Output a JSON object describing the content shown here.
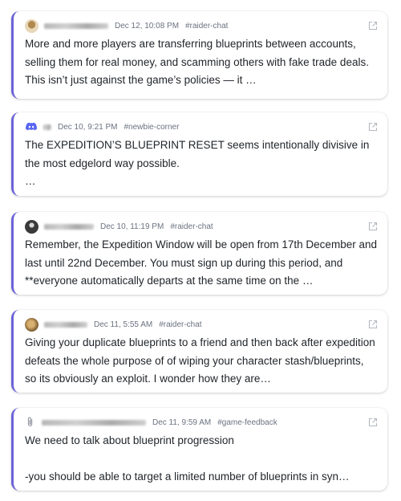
{
  "messages": [
    {
      "timestamp": "Dec 12, 10:08 PM",
      "channel": "#raider-chat",
      "avatar": "beige-avatar",
      "text": "More and more players are transferring blueprints between accounts, selling them for real money, and scamming others with fake trade deals. This isn’t just against the game’s policies — it …"
    },
    {
      "timestamp": "Dec 10, 9:21 PM",
      "channel": "#newbie-corner",
      "avatar": "discord-icon",
      "text": "The EXPEDITION’S BLUEPRINT RESET seems intentionally divisive in the most edgelord way possible.\n…"
    },
    {
      "timestamp": "Dec 10, 11:19 PM",
      "channel": "#raider-chat",
      "avatar": "dark-avatar",
      "text": "Remember, the Expedition Window will be open from 17th December and last until 22nd December. You must sign up during this period, and **everyone automatically departs at the same time on the …"
    },
    {
      "timestamp": "Dec 11, 5:55 AM",
      "channel": "#raider-chat",
      "avatar": "brown-avatar",
      "text": "Giving your duplicate blueprints to a friend and then back after expedition defeats the whole purpose of of wiping your character stash/blueprints, so its obviously an exploit. I wonder how they are…"
    },
    {
      "timestamp": "Dec 11, 9:59 AM",
      "channel": "#game-feedback",
      "avatar": "paperclip-avatar",
      "text": "We need to talk about blueprint progression\n\n-you should be able to target a limited number of blueprints in syn…"
    }
  ],
  "colors": {
    "accent": "#6c63d9",
    "discord": "#5865f2",
    "meta_text": "#6b7280",
    "body_text": "#1f2328"
  }
}
